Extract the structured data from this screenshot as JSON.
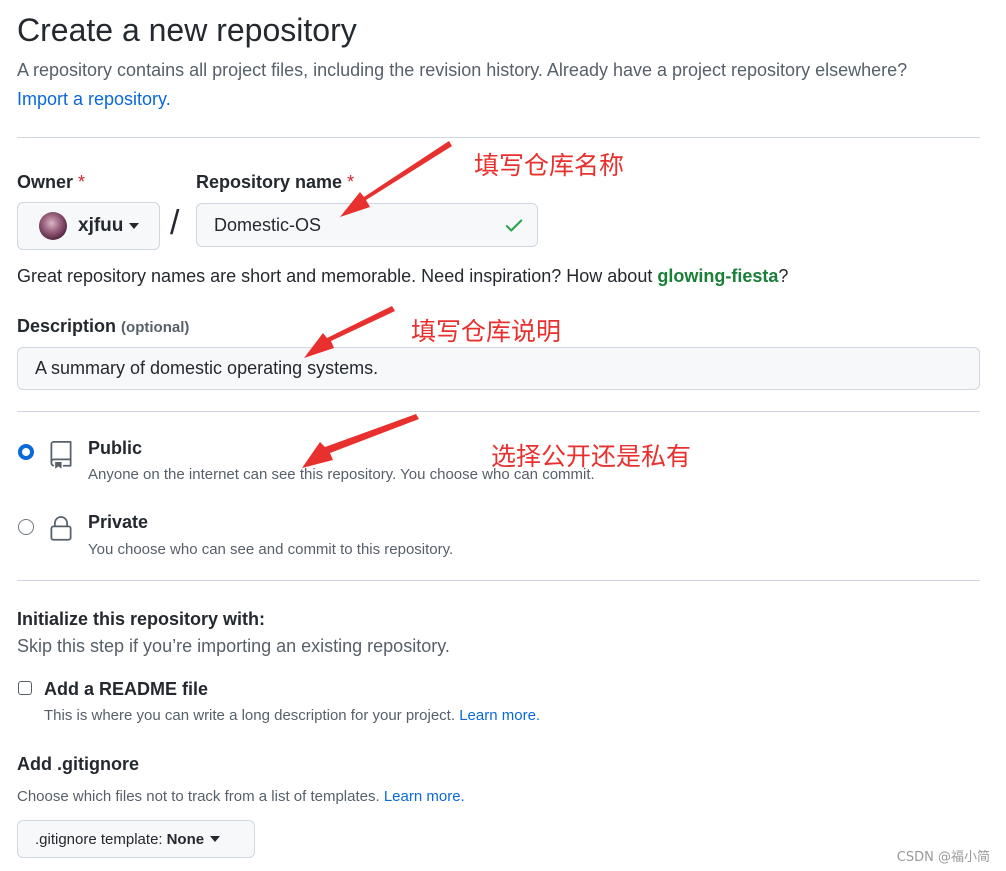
{
  "header": {
    "title": "Create a new repository",
    "intro": "A repository contains all project files, including the revision history. Already have a project repository elsewhere?",
    "import_link": "Import a repository."
  },
  "owner": {
    "label": "Owner",
    "required_mark": "*",
    "selected": "xjfuu",
    "avatar_icon": "avatar"
  },
  "separator": "/",
  "repo_name": {
    "label": "Repository name",
    "required_mark": "*",
    "value": "Domestic-OS",
    "valid_icon": "check-icon"
  },
  "hint": {
    "text": "Great repository names are short and memorable. Need inspiration? How about",
    "suggestion": "glowing-fiesta",
    "trailing": "?"
  },
  "description": {
    "label": "Description",
    "optional": "(optional)",
    "value": "A summary of domestic operating systems."
  },
  "visibility": {
    "public": {
      "title": "Public",
      "desc": "Anyone on the internet can see this repository. You choose who can commit.",
      "icon": "repo-icon",
      "selected": true
    },
    "private": {
      "title": "Private",
      "desc": "You choose who can see and commit to this repository.",
      "icon": "lock-icon",
      "selected": false
    }
  },
  "initialize": {
    "heading": "Initialize this repository with:",
    "sub": "Skip this step if you’re importing an existing repository.",
    "readme": {
      "label": "Add a README file",
      "desc": "This is where you can write a long description for your project.",
      "link": "Learn more.",
      "checked": false
    }
  },
  "gitignore": {
    "heading": "Add .gitignore",
    "desc": "Choose which files not to track from a list of templates.",
    "link": "Learn more.",
    "button_prefix": ".gitignore template:",
    "button_value": "None"
  },
  "annotations": {
    "name": "填写仓库名称",
    "desc": "填写仓库说明",
    "visibility": "选择公开还是私有",
    "color": "#e8312f"
  },
  "watermark": "CSDN @福小简",
  "colors": {
    "link": "#0969da",
    "suggestion": "#1a7f37",
    "required": "#cf222e",
    "check": "#2da44e"
  }
}
